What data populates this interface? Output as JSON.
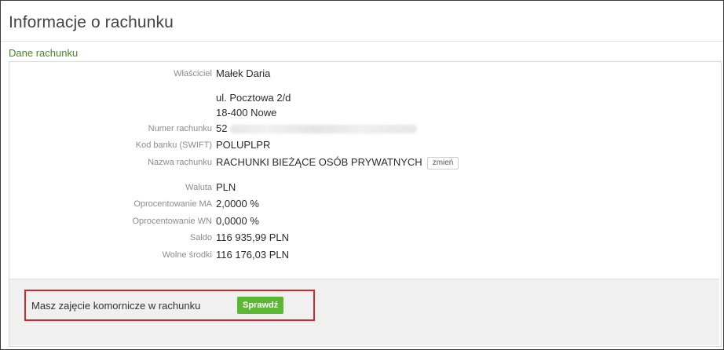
{
  "page": {
    "title": "Informacje o rachunku",
    "section": "Dane rachunku"
  },
  "details": {
    "owner_label": "Właściciel",
    "owner_value": "Małek Daria",
    "address_line1": "ul. Pocztowa 2/d",
    "address_line2": "18-400 Nowe",
    "account_number_label": "Numer rachunku",
    "account_number_value": "52",
    "swift_label": "Kod banku (SWIFT)",
    "swift_value": "POLUPLPR",
    "account_name_label": "Nazwa rachunku",
    "account_name_value": "RACHUNKI BIEŻĄCE OSÓB PRYWATNYCH",
    "change_button": "zmień",
    "currency_label": "Waluta",
    "currency_value": "PLN",
    "interest_ma_label": "Oprocentowanie MA",
    "interest_ma_value": "2,0000 %",
    "interest_wn_label": "Oprocentowanie WN",
    "interest_wn_value": "0,0000 %",
    "balance_label": "Saldo",
    "balance_value": "116 935,99 PLN",
    "available_label": "Wolne środki",
    "available_value": "116 176,03 PLN"
  },
  "notice": {
    "text": "Masz zajęcie komornicze w rachunku",
    "button": "Sprawdź"
  },
  "colors": {
    "section_green": "#3c8d1e",
    "button_green": "#5cb832",
    "highlight_red": "#d6262b"
  }
}
